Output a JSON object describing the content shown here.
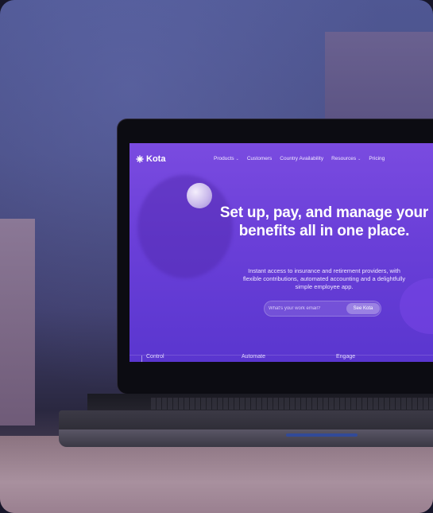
{
  "brand": {
    "name": "Kota"
  },
  "nav": {
    "products": "Products",
    "customers": "Customers",
    "country": "Country Availability",
    "resources": "Resources",
    "pricing": "Pricing",
    "chevron": "⌄"
  },
  "hero": {
    "title": "Set up, pay, and manage your benefits all in one place.",
    "subtitle": "Instant access to insurance and retirement providers, with flexible contributions, automated accounting and a delightfully simple employee app.",
    "email_placeholder": "What's your work email?",
    "cta": "See Kota"
  },
  "bottom_tabs": [
    "Control",
    "Automate",
    "Engage"
  ],
  "colors": {
    "accent": "#6a3fd8",
    "wall": "#4f5793"
  },
  "icons": {
    "logo": "kota-star-icon",
    "dropdown": "chevron-down-icon"
  }
}
